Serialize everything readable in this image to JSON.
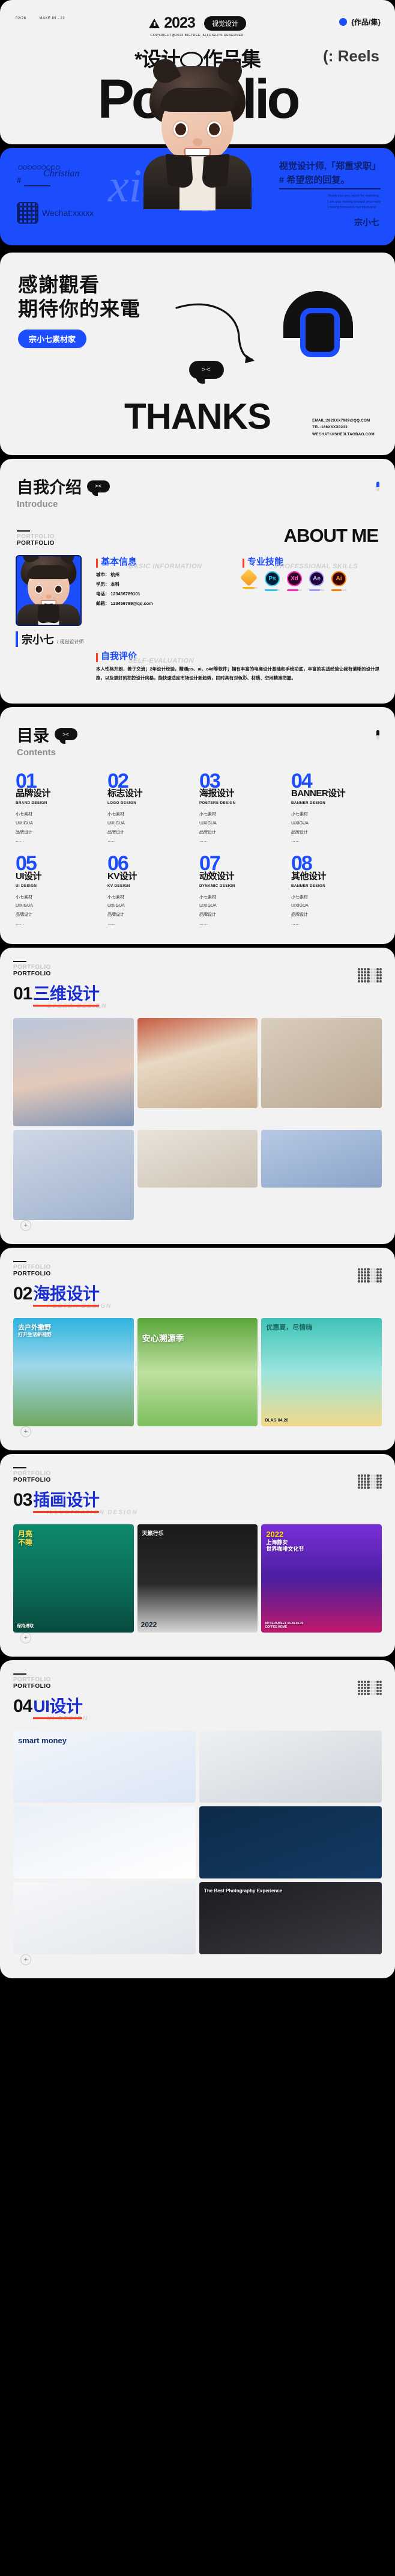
{
  "cover": {
    "meta_left": "02/26",
    "meta_right": "MAKE IN - 22",
    "year": "2023",
    "year_badge": "视觉设计",
    "copyright": "COPYRIGHT@2023 BIGTREE. ALLRIGHTS RESERVED.",
    "top_right": "{作品/集}",
    "title_cn_a": "*设计",
    "title_cn_b": "作品集",
    "reels": "(: Reels",
    "portfolio": "Portfolio",
    "signature_loops": "OOOOOOOOO",
    "signature_name": "Christian",
    "hash": "#",
    "wechat": "Wechat:xxxxx",
    "headline_1": "视觉设计师,「郑重求职」",
    "headline_2": "# 希望您的回复。",
    "en_1": "Thank you very much for watching",
    "en_2": "I am also looking forward  your reply",
    "en_3": "Looking forward to our interview!",
    "author": "宗小七",
    "watermark": "xiaoqi"
  },
  "thanks": {
    "line1": "感謝觀看",
    "line2": "期待你的来電",
    "tag": "宗小七素材家",
    "email": "EMAIL:282XXX7989@QQ.COM",
    "tel": "TEL:186XXXX0233",
    "wechat": "WECHAT:UISHEJI.TAOBAO.COM",
    "big": "THANKS",
    "face_eyes": "><"
  },
  "about": {
    "head_cn": "自我介绍",
    "head_en": "Introduce",
    "bubble": "><",
    "portfolio_mark": "PORTFOLIO",
    "portfolio_ghost": "PORTFOLIO",
    "title": "ABOUT ME",
    "basic": {
      "cn": "基本信息",
      "en": "BASIC INFORMATION",
      "rows": [
        "城市： 杭州",
        "学历： 本科",
        "电话： 123456789101",
        "邮箱： 123456789@qq.com"
      ]
    },
    "skills": {
      "cn": "专业技能",
      "en": "PROFESSIONAL SKILLS",
      "items": [
        {
          "name": "Sk",
          "label": "",
          "color": "#f7b500",
          "bg": "#ffcc33",
          "pct": 78
        },
        {
          "name": "Ps",
          "label": "Ps",
          "color": "#31c5f0",
          "bg": "#001e36",
          "pct": 82
        },
        {
          "name": "Xd",
          "label": "Xd",
          "color": "#ff2bc2",
          "bg": "#2e001f",
          "pct": 74
        },
        {
          "name": "Ae",
          "label": "Ae",
          "color": "#9999ff",
          "bg": "#1f0033",
          "pct": 70
        },
        {
          "name": "Ai",
          "label": "Ai",
          "color": "#ff7c00",
          "bg": "#330000",
          "pct": 66
        }
      ]
    },
    "evaluation": {
      "cn": "自我评价",
      "en": "SELF-EVALUATION",
      "text": "本人性格开朗，善于交流；2年设计经验，精通ps、ai、c4d等软件；拥有丰富的电商设计基础和手绘功底，丰富的实战经验让我有清晰的设计思路，以及更好的把控设计风格，能快速适应市场设计新趋势，同时具有对色彩、材质、空间精准把握。"
    },
    "person_name": "宗小七",
    "person_role": "/ 视觉设计师"
  },
  "contents": {
    "head_cn": "目录",
    "head_en": "Contents",
    "bubble": "><",
    "items": [
      {
        "num": "01",
        "cn": "品牌设计",
        "en": "BRAND DESIGN",
        "sub": "小七素材\nUIXIGUA\n品牌设计\n……"
      },
      {
        "num": "02",
        "cn": "标志设计",
        "en": "LOGO DESIGN",
        "sub": "小七素材\nUIXIGUA\n品牌设计\n……"
      },
      {
        "num": "03",
        "cn": "海报设计",
        "en": "POSTERS DESIGN",
        "sub": "小七素材\nUIXIGUA\n品牌设计\n……"
      },
      {
        "num": "04",
        "cn": "BANNER设计",
        "en": "BANNER DESIGN",
        "sub": "小七素材\nUIXIGUA\n品牌设计\n……"
      },
      {
        "num": "05",
        "cn": "UI设计",
        "en": "UI DESIGN",
        "sub": "小七素材\nUIXIGUA\n品牌设计\n……"
      },
      {
        "num": "06",
        "cn": "KV设计",
        "en": "KV DESIGN",
        "sub": "小七素材\nUIXIGUA\n品牌设计\n……"
      },
      {
        "num": "07",
        "cn": "动效设计",
        "en": "DYNAMIC DESIGN",
        "sub": "小七素材\nUIXIGUA\n品牌设计\n……"
      },
      {
        "num": "08",
        "cn": "其他设计",
        "en": "BANNER DESIGN",
        "sub": "小七素材\nUIXIGUA\n品牌设计\n……"
      }
    ]
  },
  "sections": [
    {
      "mark": "PORTFOLIO",
      "num": "01",
      "cn": "三维设计",
      "en": "OPERA DESIGN"
    },
    {
      "mark": "PORTFOLIO",
      "num": "02",
      "cn": "海报设计",
      "en": "POSTER DESIGN"
    },
    {
      "mark": "PORTFOLIO",
      "num": "03",
      "cn": "插画设计",
      "en": "ILLUSTRATION DESIGN"
    },
    {
      "mark": "PORTFOLIO",
      "num": "04",
      "cn": "UI设计",
      "en": "UI DESIGN"
    }
  ],
  "posters": {
    "p1_l1": "去户外撒野",
    "p1_l2": "打开生活新视野",
    "p2": "安心溯源季",
    "p3_l1": "优惠夏，尽情嗨",
    "p3_tag": "DLAS·04.20",
    "p4_1": "2022",
    "p4_2": "上海静安",
    "p4_3": "世界咖啡文化节",
    "p4_4": "BITTERSWEET 05.28-05.30",
    "p4_5": "COFFEE HOME",
    "p5": "保持进取",
    "p6": "天籁行乐",
    "ui_1": "smart money",
    "ui_2": "The Best Photography Experience"
  },
  "colors": {
    "accent_blue": "#1b4dfd",
    "accent_red": "#ff3a1e",
    "bg_card": "#f2f2f2",
    "bg_page": "#000000"
  }
}
